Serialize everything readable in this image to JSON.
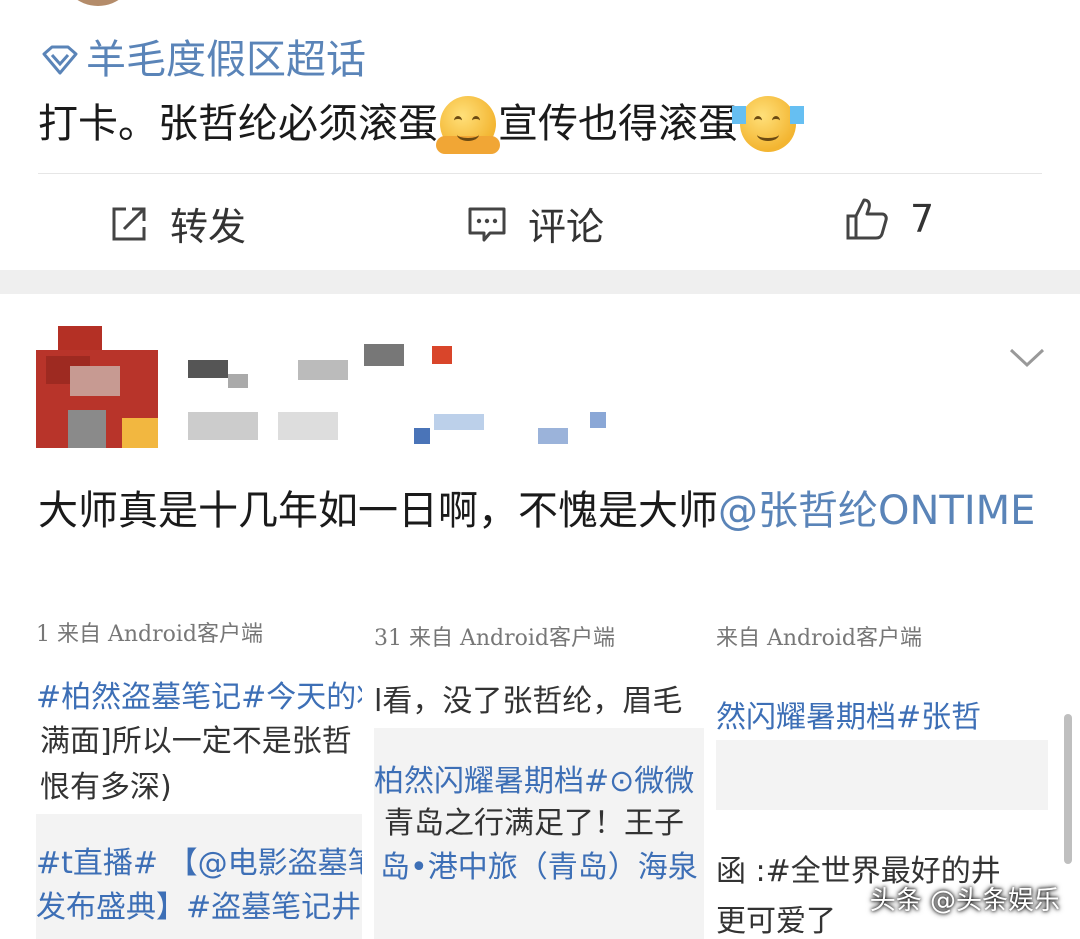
{
  "post1": {
    "topic": "羊毛度假区超话",
    "text_a": "打卡。张哲纶必须滚蛋",
    "text_b": "宣传也得滚蛋",
    "actions": {
      "repost": "转发",
      "comment": "评论",
      "like_count": "7"
    }
  },
  "post2": {
    "text": "大师真是十几年如一日啊，不愧是大师",
    "mention": "@张哲纶ONTIME"
  },
  "shots": [
    {
      "from": "1 来自 Android客户端",
      "lines": [
        "#柏然盗墓笔记#今天的妆",
        "满面]所以一定不是张哲",
        "恨有多深)",
        "#t直播# 【@电影盗墓笔记",
        "发布盛典】#盗墓笔记井柏"
      ]
    },
    {
      "from": "31 来自 Android客户端",
      "lines": [
        "l看，没了张哲纶，眉毛",
        "柏然闪耀暑期档#⊙微微",
        "青岛之行满足了！王子",
        "岛•港中旅（青岛）海泉"
      ]
    },
    {
      "from": "来自 Android客户端",
      "lines": [
        "然闪耀暑期档#张哲",
        "函 :#全世界最好的井",
        "更可爱了"
      ]
    }
  ],
  "watermark": "头条 @头条娱乐"
}
